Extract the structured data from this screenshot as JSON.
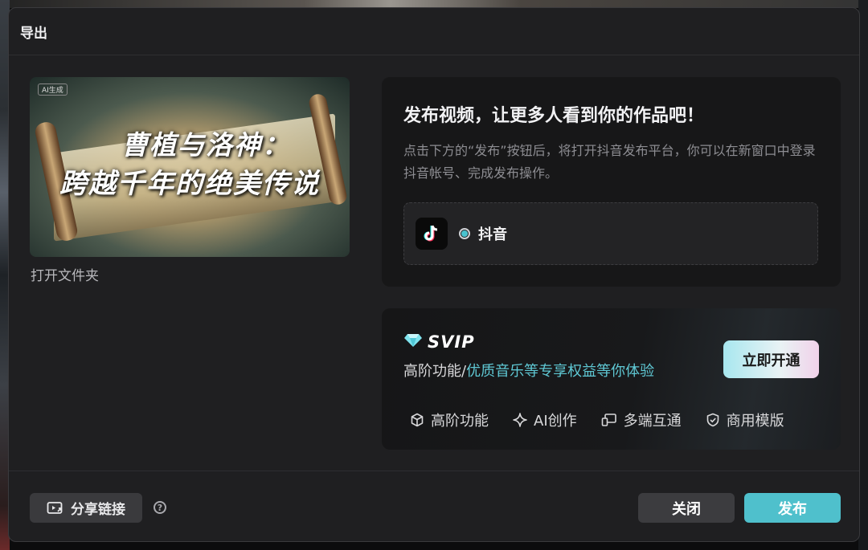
{
  "dialog": {
    "title": "导出"
  },
  "preview": {
    "tag": "AI生成",
    "title_line1": "曹植与洛神：",
    "title_line2": "跨越千年的绝美传说",
    "open_folder": "打开文件夹"
  },
  "publish": {
    "title": "发布视频，让更多人看到你的作品吧！",
    "description": "点击下方的“发布”按钮后，将打开抖音发布平台，你可以在新窗口中登录抖音帐号、完成发布操作。",
    "platform": {
      "label": "抖音",
      "selected": true,
      "icon": "douyin-icon"
    }
  },
  "svip": {
    "badge": "SVIP",
    "subtitle_prefix": "高阶功能/",
    "subtitle_highlight": "优质音乐等专享权益等你体验",
    "open_button": "立即开通",
    "features": [
      {
        "icon": "cube-icon",
        "label": "高阶功能"
      },
      {
        "icon": "sparkle-icon",
        "label": "AI创作"
      },
      {
        "icon": "multi-device-icon",
        "label": "多端互通"
      },
      {
        "icon": "shield-check-icon",
        "label": "商用模版"
      }
    ]
  },
  "footer": {
    "share_label": "分享链接",
    "help_glyph": "?",
    "close_label": "关闭",
    "publish_label": "发布"
  },
  "colors": {
    "accent": "#4fc0cc",
    "background": "#1f1f21"
  }
}
